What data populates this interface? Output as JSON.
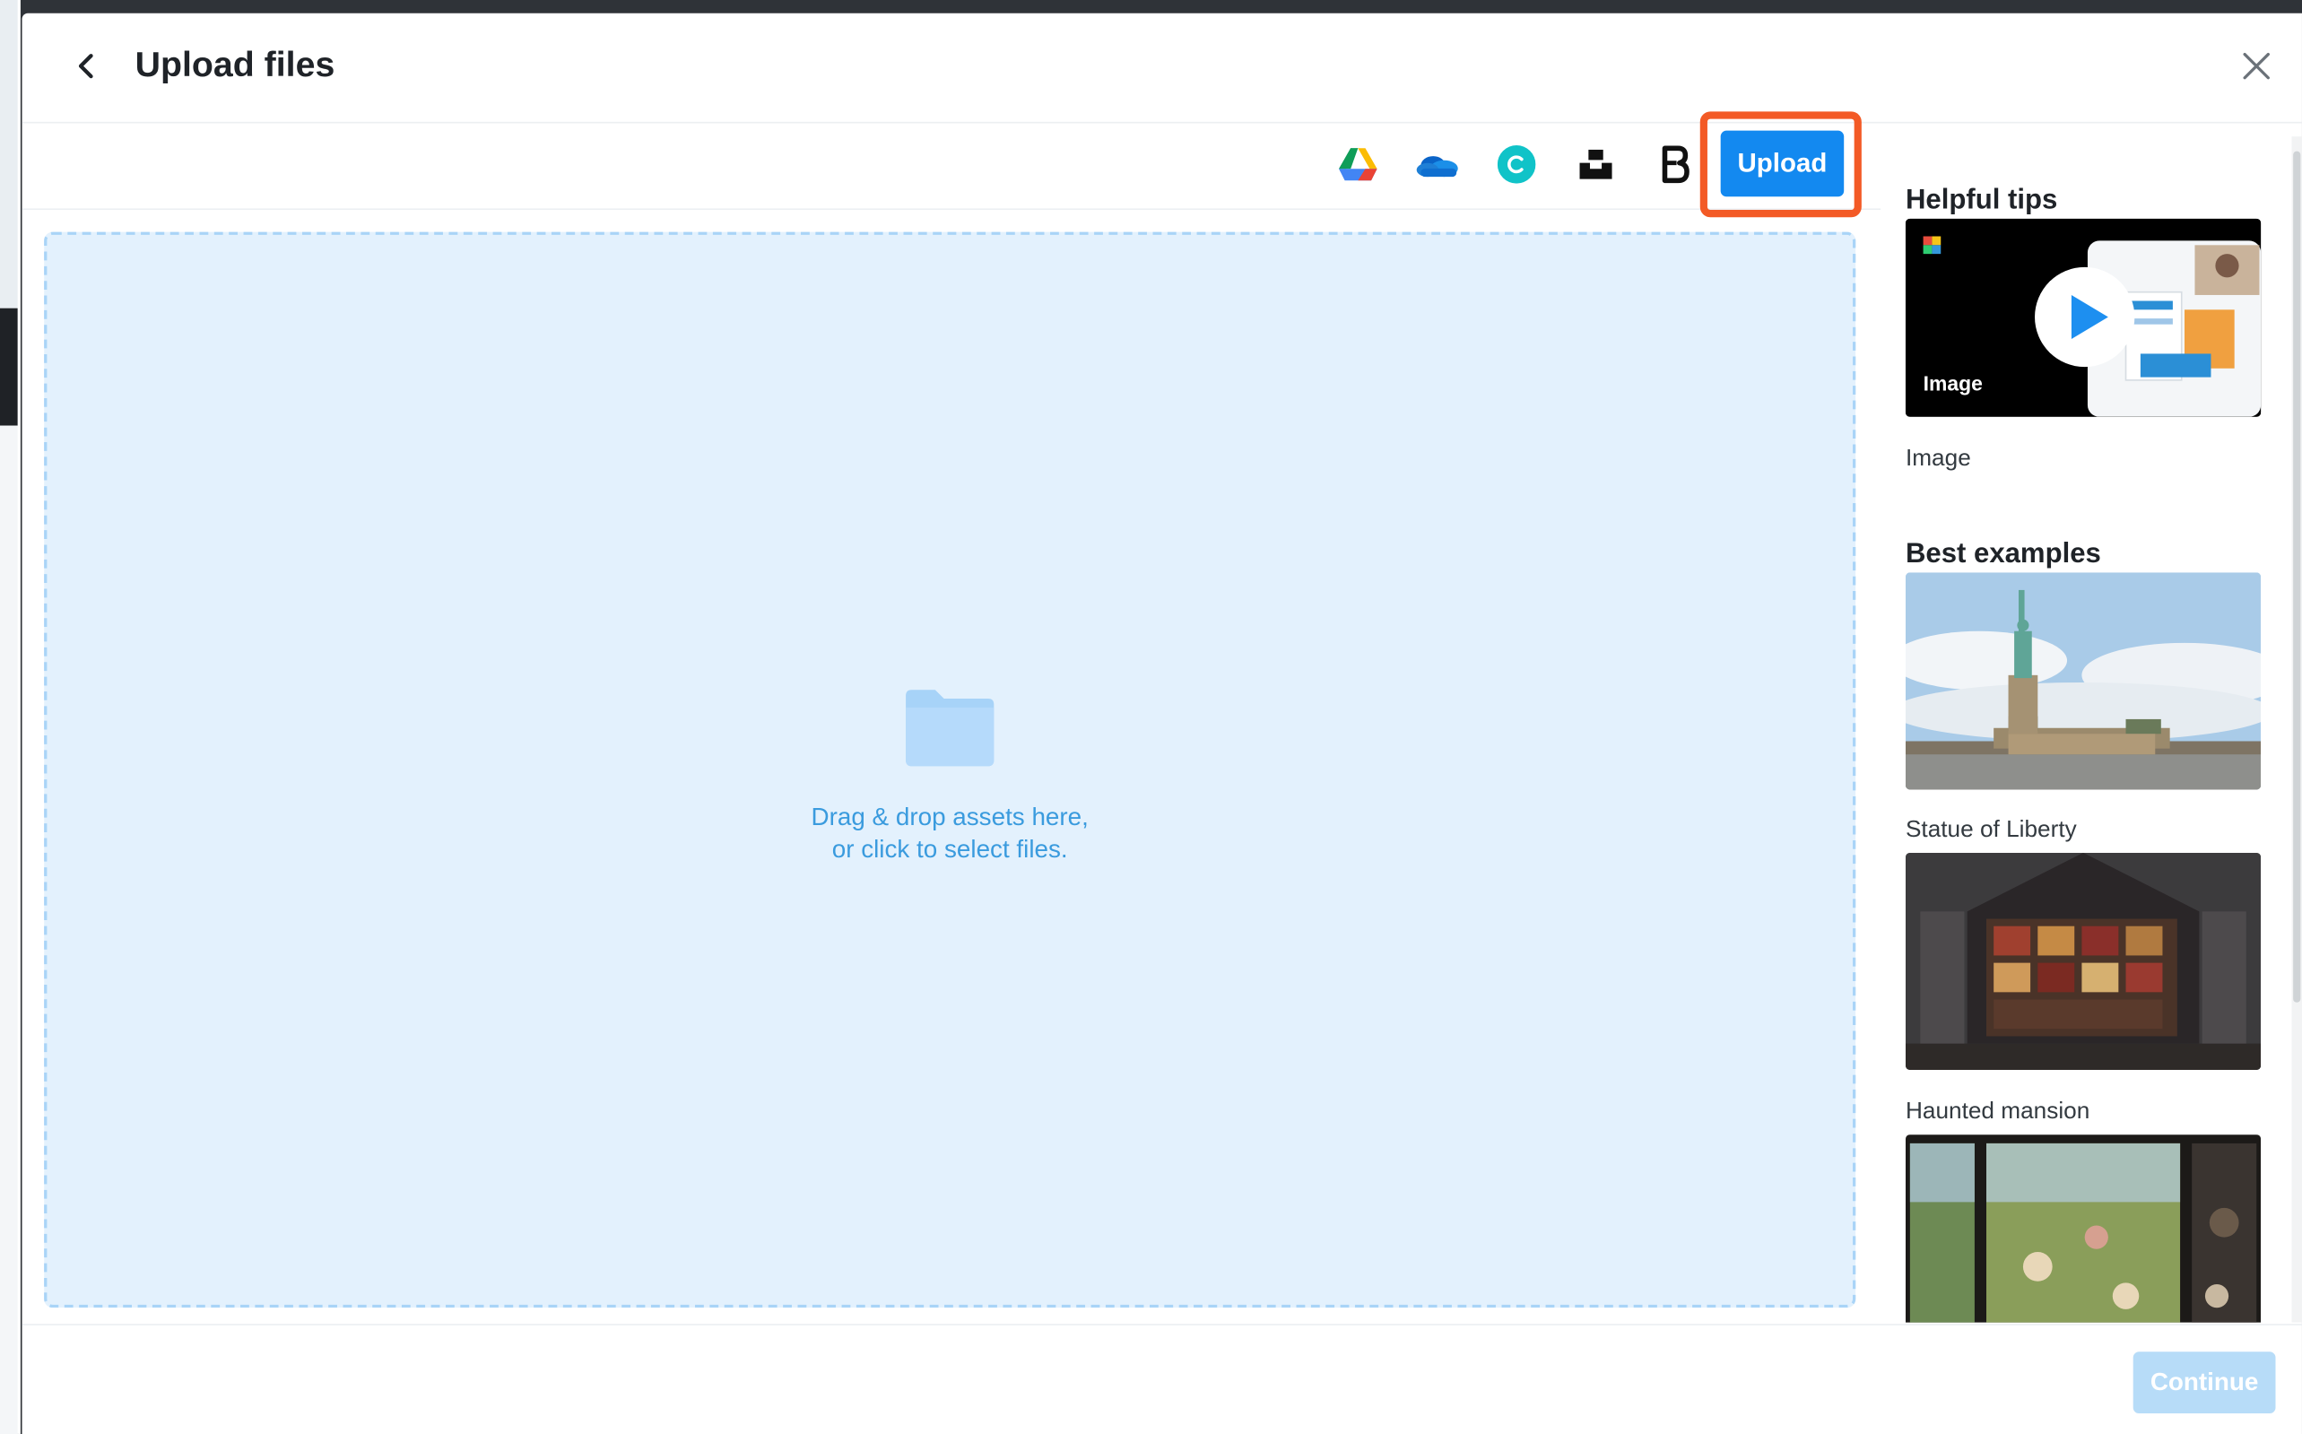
{
  "header": {
    "title": "Upload files"
  },
  "toolbar": {
    "sources": [
      "google-drive",
      "onedrive",
      "canva",
      "unsplash",
      "box"
    ],
    "upload_label": "Upload",
    "highlight_color": "#f35a26",
    "accent_color": "#1389f0"
  },
  "dropzone": {
    "line1": "Drag & drop assets here,",
    "line2": "or click to select files."
  },
  "sidebar": {
    "tips_heading": "Helpful tips",
    "video": {
      "overlay_label": "Image",
      "caption": "Image"
    },
    "examples_heading": "Best examples",
    "examples": [
      {
        "caption": "Statue of Liberty"
      },
      {
        "caption": "Haunted mansion"
      },
      {
        "caption": ""
      }
    ]
  },
  "footer": {
    "continue_label": "Continue"
  }
}
